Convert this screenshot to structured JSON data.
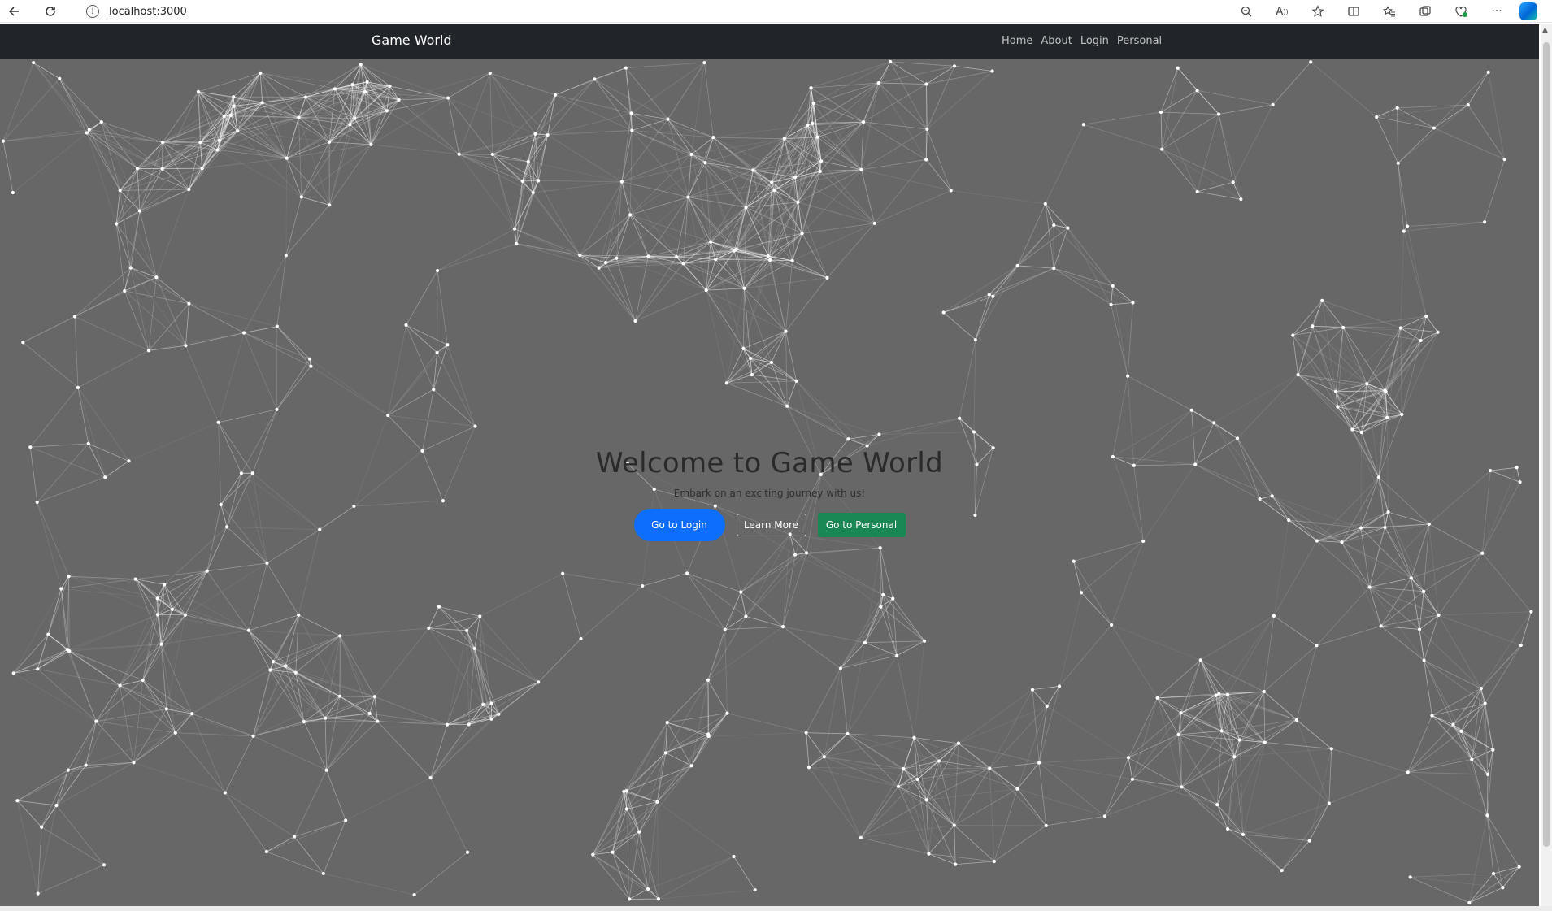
{
  "browser": {
    "url": "localhost:3000",
    "back_icon": "arrow-left-icon",
    "reload_icon": "reload-icon",
    "info_icon": "info-icon",
    "right_icons": [
      "zoom-out-icon",
      "read-aloud-icon",
      "favorite-star-icon",
      "split-screen-icon",
      "favorites-icon",
      "collections-icon",
      "browser-essentials-icon",
      "more-icon",
      "copilot-icon"
    ]
  },
  "navbar": {
    "brand": "Game World",
    "links": [
      "Home",
      "About",
      "Login",
      "Personal"
    ]
  },
  "hero": {
    "title": "Welcome to Game World",
    "subtitle": "Embark on an exciting journey with us!",
    "buttons": {
      "login": "Go to Login",
      "learn": "Learn More",
      "personal": "Go to Personal"
    }
  },
  "colors": {
    "page_background": "#676767",
    "navbar_background": "#212529",
    "network_lines": "#ffffff",
    "primary": "#0d6efd",
    "success": "#198754"
  }
}
